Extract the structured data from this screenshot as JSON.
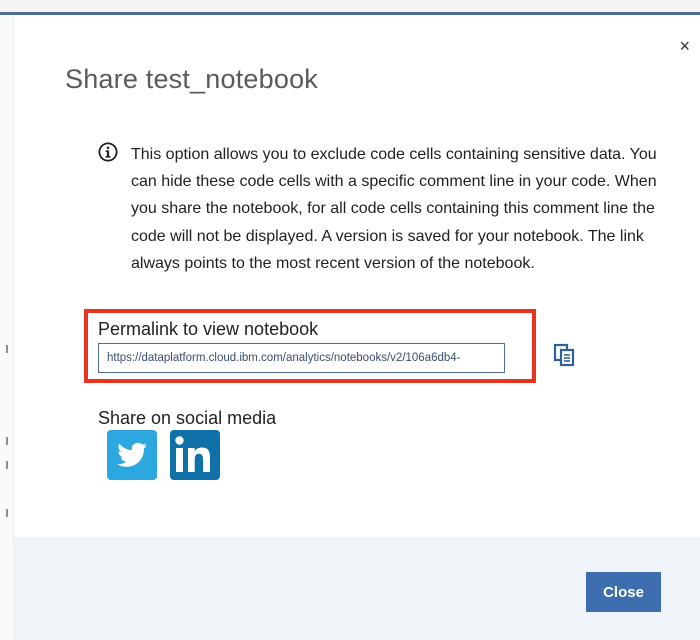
{
  "dialog": {
    "title": "Share test_notebook",
    "close_icon": "close-icon",
    "close_glyph": "×",
    "info_icon": "info-circle-icon",
    "info_text": "This option allows you to exclude code cells containing sensitive data. You can hide these code cells with a specific comment line in your code. When you share the notebook, for all code cells containing this comment line the code will not be displayed. A version is saved for your notebook. The link always points to the most recent version of the notebook.",
    "permalink": {
      "label": "Permalink to view notebook",
      "value": "https://dataplatform.cloud.ibm.com/analytics/notebooks/v2/106a6db4-",
      "copy_icon": "copy-icon"
    },
    "social": {
      "label": "Share on social media",
      "buttons": [
        {
          "name": "twitter",
          "icon": "twitter-icon"
        },
        {
          "name": "linkedin",
          "icon": "linkedin-icon"
        }
      ]
    },
    "footer": {
      "close_label": "Close"
    }
  },
  "colors": {
    "accent": "#3d6fb0",
    "highlight": "#e8331f",
    "twitter": "#2da7e0",
    "linkedin": "#0f71a8",
    "footer_bg": "#f1f4f8"
  }
}
